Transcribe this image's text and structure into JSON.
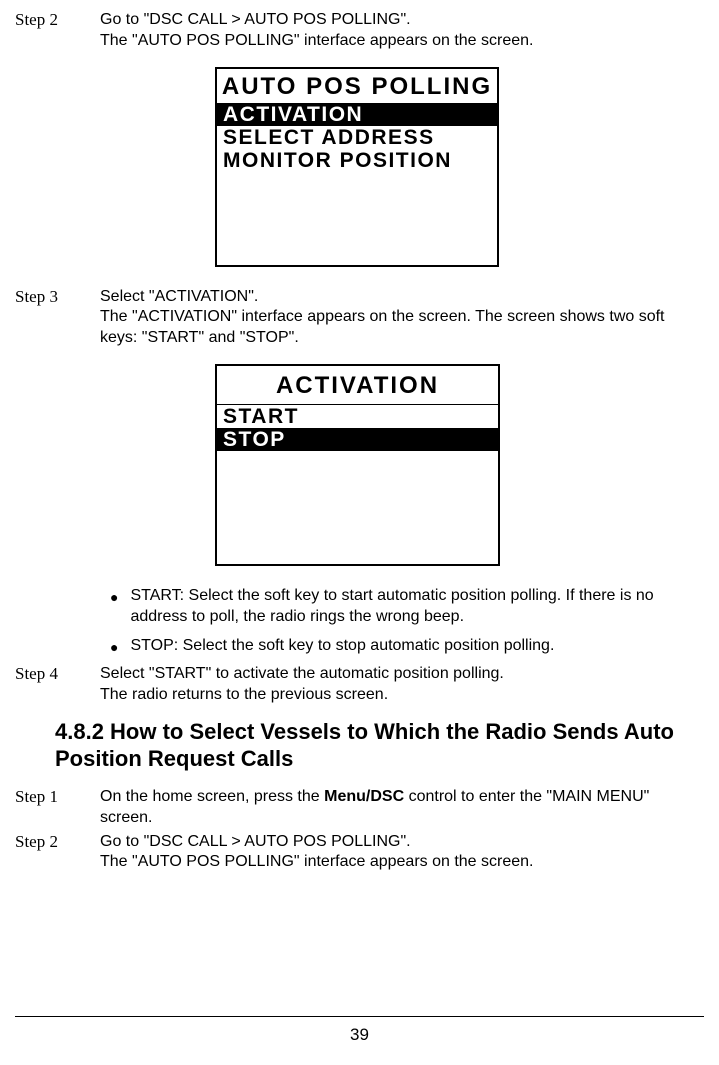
{
  "steps_a": {
    "s2": {
      "label": "Step 2",
      "line1": "Go to \"DSC CALL > AUTO POS POLLING\".",
      "line2": "The \"AUTO POS POLLING\" interface appears on the screen."
    },
    "s3": {
      "label": "Step 3",
      "line1": "Select \"ACTIVATION\".",
      "line2": "The \"ACTIVATION\" interface appears on the screen. The screen shows two soft keys: \"START\" and \"STOP\"."
    },
    "s4": {
      "label": "Step 4",
      "line1": "Select \"START\" to activate the automatic position polling.",
      "line2": "The radio returns to the previous screen."
    }
  },
  "lcd1": {
    "title": "AUTO POS POLLING",
    "items": [
      "ACTIVATION",
      "SELECT ADDRESS",
      "MONITOR POSITION"
    ]
  },
  "lcd2": {
    "title": "ACTIVATION",
    "items": [
      "START",
      "STOP"
    ]
  },
  "bullets": {
    "b1": "START: Select the soft key to start automatic position polling. If there is no address to poll, the radio rings the wrong beep.",
    "b2": "STOP: Select the soft key to stop automatic position polling."
  },
  "heading": "4.8.2 How to Select Vessels to Which the Radio Sends Auto Position Request Calls",
  "steps_b": {
    "s1": {
      "label": "Step 1",
      "pre": "On the home screen, press the ",
      "bold": "Menu/DSC",
      "post": " control to enter the \"MAIN MENU\" screen."
    },
    "s2": {
      "label": "Step 2",
      "line1": "Go to \"DSC CALL > AUTO POS POLLING\".",
      "line2": "The \"AUTO POS POLLING\" interface appears on the screen."
    }
  },
  "page_number": "39"
}
